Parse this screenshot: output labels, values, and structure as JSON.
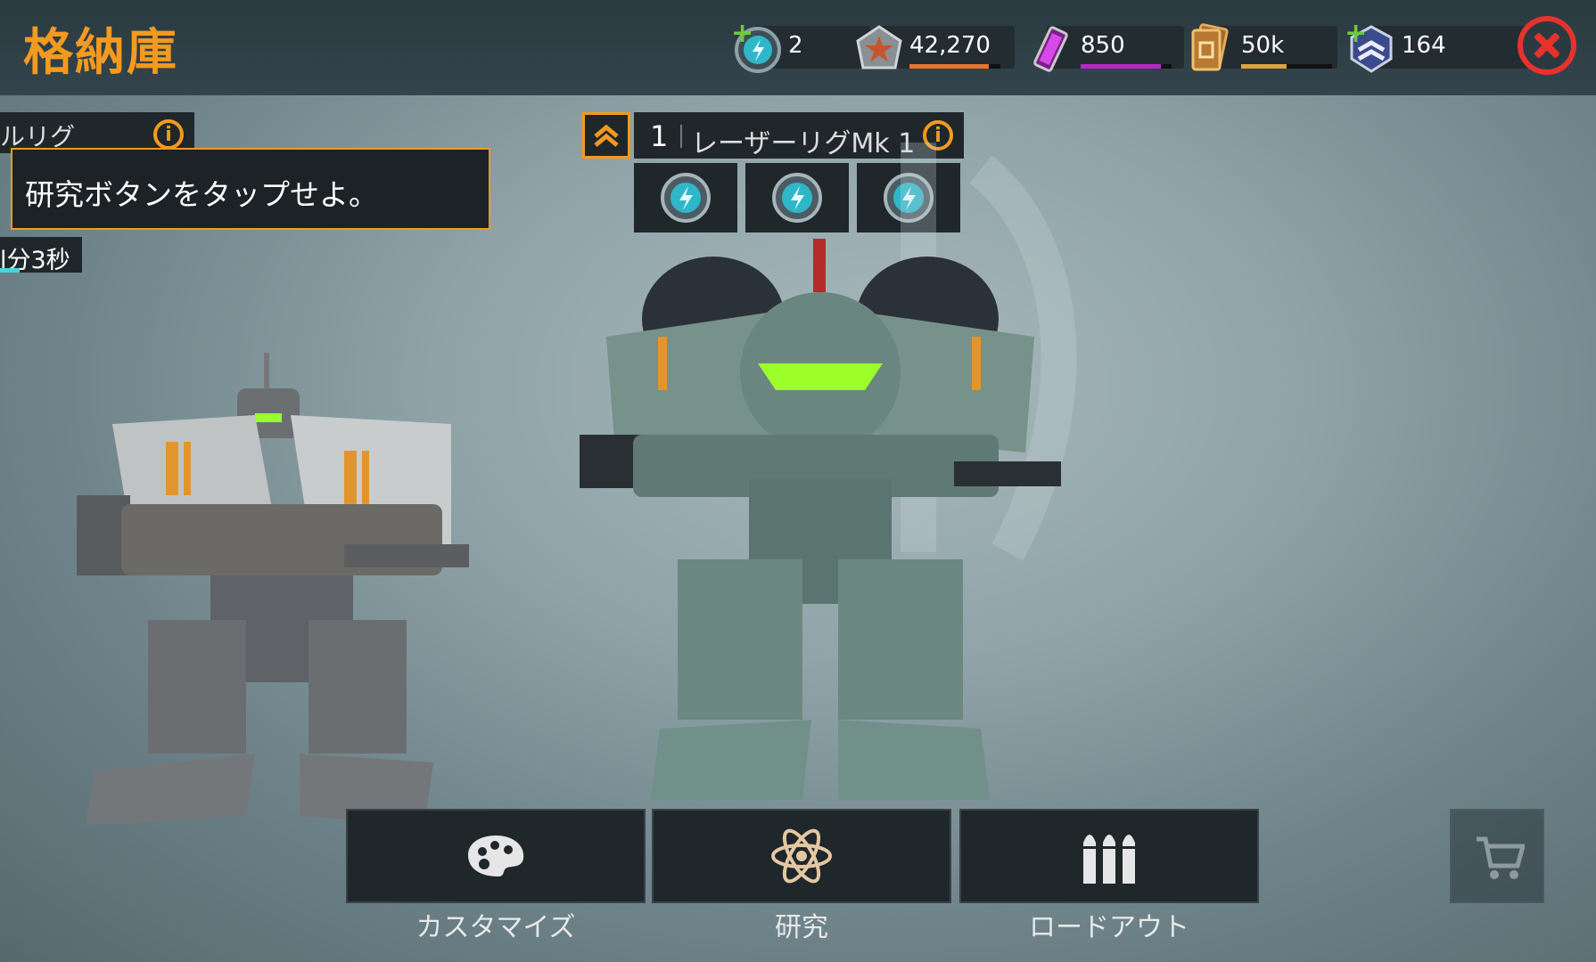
{
  "header": {
    "title": "格納庫"
  },
  "resources": [
    {
      "name": "power-cells",
      "value": "2",
      "icon": "power-cell-icon",
      "plus": true,
      "bar_color": "",
      "bar_fill": 0
    },
    {
      "name": "silver",
      "value": "42,270",
      "icon": "silver-star-icon",
      "plus": false,
      "bar_color": "#e8742a",
      "bar_fill": 0.87
    },
    {
      "name": "gold",
      "value": "850",
      "icon": "purple-canister-icon",
      "plus": false,
      "bar_color": "#b527c7",
      "bar_fill": 0.88
    },
    {
      "name": "key",
      "value": "50k",
      "icon": "card-icon",
      "plus": false,
      "bar_color": "#e0a23a",
      "bar_fill": 0.5
    },
    {
      "name": "rank-points",
      "value": "164",
      "icon": "chevron-rank-icon",
      "plus": true,
      "bar_color": "",
      "bar_fill": 0
    }
  ],
  "left_card": {
    "name": "ルリグ",
    "tooltip": "研究ボタンをタップせよ。",
    "timer": "l分3秒"
  },
  "center_card": {
    "level": "1",
    "name": "レーザーリグMk 1",
    "slots": [
      "power-slot-icon",
      "power-slot-icon",
      "power-slot-icon"
    ]
  },
  "buttons": {
    "customize": "カスタマイズ",
    "research": "研究",
    "loadout": "ロードアウト"
  },
  "colors": {
    "accent": "#f39a1f",
    "close": "#e5332b",
    "panel": "#1f272b"
  }
}
